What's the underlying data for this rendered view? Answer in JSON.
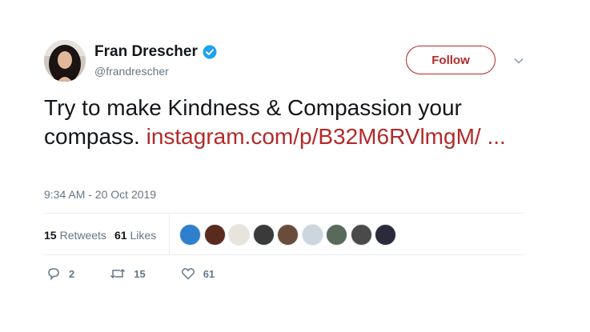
{
  "author": {
    "display_name": "Fran Drescher",
    "handle": "@frandrescher",
    "verified": true
  },
  "follow_button": {
    "label": "Follow"
  },
  "tweet": {
    "text": "Try to make Kindness & Compassion your compass.",
    "link_text": "instagram.com/p/B32M6RVlmgM/ ...",
    "timestamp": "9:34 AM - 20 Oct 2019"
  },
  "stats": {
    "retweets_count": "15",
    "retweets_label": "Retweets",
    "likes_count": "61",
    "likes_label": "Likes"
  },
  "likers": [
    {
      "color": "#2f7fcf"
    },
    {
      "color": "#5a2a1e"
    },
    {
      "color": "#e8e4dc"
    },
    {
      "color": "#3a3a3a"
    },
    {
      "color": "#6b4c3a"
    },
    {
      "color": "#cdd6dd"
    },
    {
      "color": "#5a6a5a"
    },
    {
      "color": "#4a4a4a"
    },
    {
      "color": "#2a2a3a"
    }
  ],
  "actions": {
    "reply_count": "2",
    "retweet_count": "15",
    "like_count": "61"
  },
  "colors": {
    "link": "#b42929",
    "secondary_text": "#657786",
    "verified": "#1da1f2"
  },
  "icons": {
    "verified": "verified-badge-icon",
    "caret": "chevron-down-icon",
    "reply": "reply-icon",
    "retweet": "retweet-icon",
    "like": "heart-icon"
  }
}
